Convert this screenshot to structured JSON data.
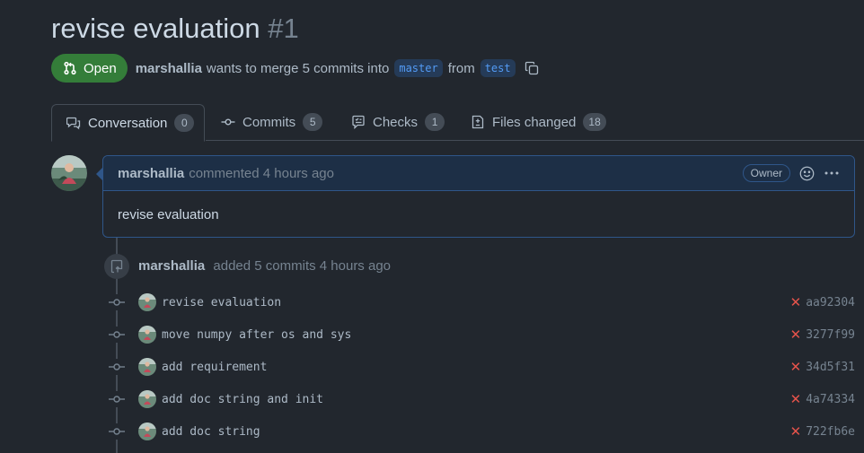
{
  "pr": {
    "title": "revise evaluation",
    "number": "#1",
    "state": "Open",
    "author": "marshallia",
    "merge_text": "wants to merge 5 commits into",
    "base_branch": "master",
    "from_text": "from",
    "head_branch": "test"
  },
  "tabs": [
    {
      "label": "Conversation",
      "count": "0",
      "icon": "conversation-icon"
    },
    {
      "label": "Commits",
      "count": "5",
      "icon": "commit-icon"
    },
    {
      "label": "Checks",
      "count": "1",
      "icon": "checks-icon"
    },
    {
      "label": "Files changed",
      "count": "18",
      "icon": "file-diff-icon"
    }
  ],
  "comment": {
    "author": "marshallia",
    "action": "commented 4 hours ago",
    "role": "Owner",
    "body": "revise evaluation"
  },
  "event": {
    "author": "marshallia",
    "text": "added 5 commits 4 hours ago"
  },
  "commits": [
    {
      "message": "revise evaluation",
      "status": "✕",
      "sha": "aa92304"
    },
    {
      "message": "move numpy after os and sys",
      "status": "✕",
      "sha": "3277f99"
    },
    {
      "message": "add requirement",
      "status": "✕",
      "sha": "34d5f31"
    },
    {
      "message": "add doc string and init",
      "status": "✕",
      "sha": "4a74334"
    },
    {
      "message": "add doc string",
      "status": "✕",
      "sha": "722fb6e"
    }
  ],
  "colors": {
    "background": "#22272e",
    "open_green": "#347d39",
    "link_blue": "#539bf5",
    "fail_red": "#e5534b"
  }
}
